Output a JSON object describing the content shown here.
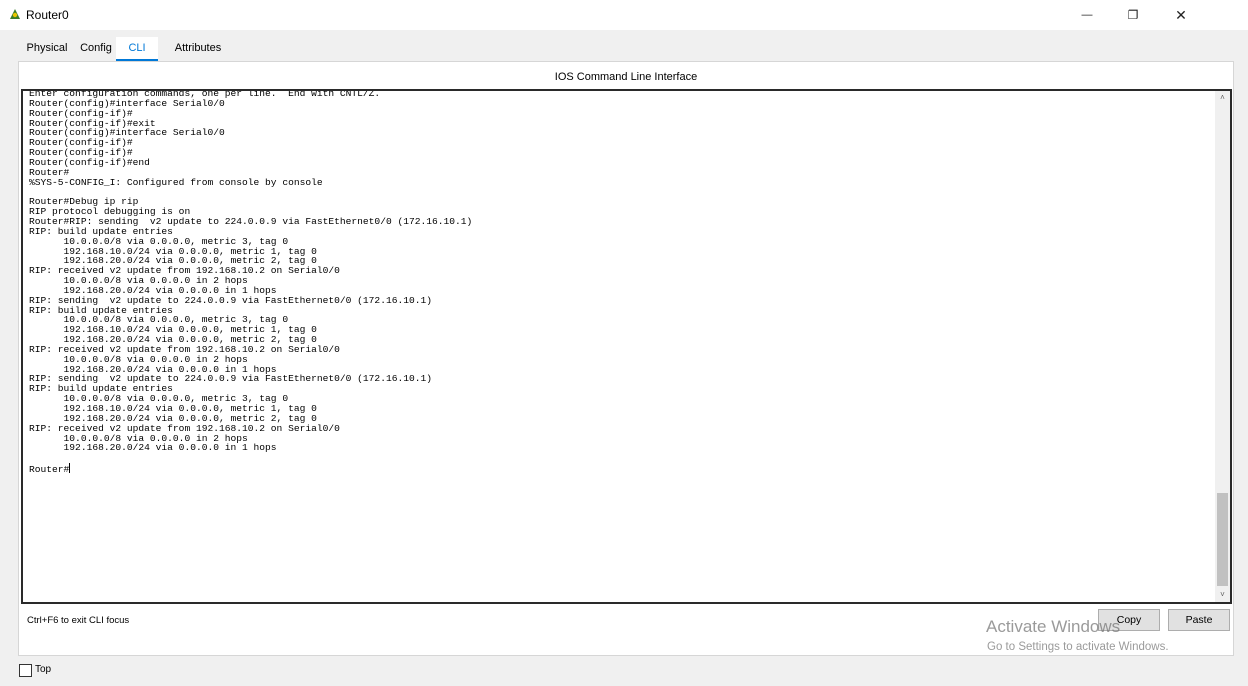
{
  "window": {
    "title": "Router0",
    "minimize_glyph": "—",
    "maximize_glyph": "❐",
    "close_glyph": "✕"
  },
  "tabs": [
    {
      "label": "Physical",
      "active": false
    },
    {
      "label": "Config",
      "active": false
    },
    {
      "label": "CLI",
      "active": true
    },
    {
      "label": "Attributes",
      "active": false
    }
  ],
  "cli": {
    "header": "IOS Command Line Interface",
    "lines": [
      "Enter configuration commands, one per line.  End with CNTL/Z.",
      "Router(config)#interface Serial0/0",
      "Router(config-if)#",
      "Router(config-if)#exit",
      "Router(config)#interface Serial0/0",
      "Router(config-if)#",
      "Router(config-if)#",
      "Router(config-if)#end",
      "Router#",
      "%SYS-5-CONFIG_I: Configured from console by console",
      "",
      "Router#Debug ip rip",
      "RIP protocol debugging is on",
      "Router#RIP: sending  v2 update to 224.0.0.9 via FastEthernet0/0 (172.16.10.1)",
      "RIP: build update entries",
      "      10.0.0.0/8 via 0.0.0.0, metric 3, tag 0",
      "      192.168.10.0/24 via 0.0.0.0, metric 1, tag 0",
      "      192.168.20.0/24 via 0.0.0.0, metric 2, tag 0",
      "RIP: received v2 update from 192.168.10.2 on Serial0/0",
      "      10.0.0.0/8 via 0.0.0.0 in 2 hops",
      "      192.168.20.0/24 via 0.0.0.0 in 1 hops",
      "RIP: sending  v2 update to 224.0.0.9 via FastEthernet0/0 (172.16.10.1)",
      "RIP: build update entries",
      "      10.0.0.0/8 via 0.0.0.0, metric 3, tag 0",
      "      192.168.10.0/24 via 0.0.0.0, metric 1, tag 0",
      "      192.168.20.0/24 via 0.0.0.0, metric 2, tag 0",
      "RIP: received v2 update from 192.168.10.2 on Serial0/0",
      "      10.0.0.0/8 via 0.0.0.0 in 2 hops",
      "      192.168.20.0/24 via 0.0.0.0 in 1 hops",
      "RIP: sending  v2 update to 224.0.0.9 via FastEthernet0/0 (172.16.10.1)",
      "RIP: build update entries",
      "      10.0.0.0/8 via 0.0.0.0, metric 3, tag 0",
      "      192.168.10.0/24 via 0.0.0.0, metric 1, tag 0",
      "      192.168.20.0/24 via 0.0.0.0, metric 2, tag 0",
      "RIP: received v2 update from 192.168.10.2 on Serial0/0",
      "      10.0.0.0/8 via 0.0.0.0 in 2 hops",
      "      192.168.20.0/24 via 0.0.0.0 in 1 hops",
      "",
      "Router#"
    ],
    "hint": "Ctrl+F6 to exit CLI focus",
    "copy_label": "Copy",
    "paste_label": "Paste",
    "scroll_up_glyph": "˄",
    "scroll_down_glyph": "˅"
  },
  "watermark": {
    "title": "Activate Windows",
    "subtitle": "Go to Settings to activate Windows."
  },
  "footer": {
    "top_label": "Top",
    "top_checked": false
  },
  "colors": {
    "accent": "#0078d7",
    "console_border": "#2a2a2a",
    "background": "#f0f0f0"
  }
}
